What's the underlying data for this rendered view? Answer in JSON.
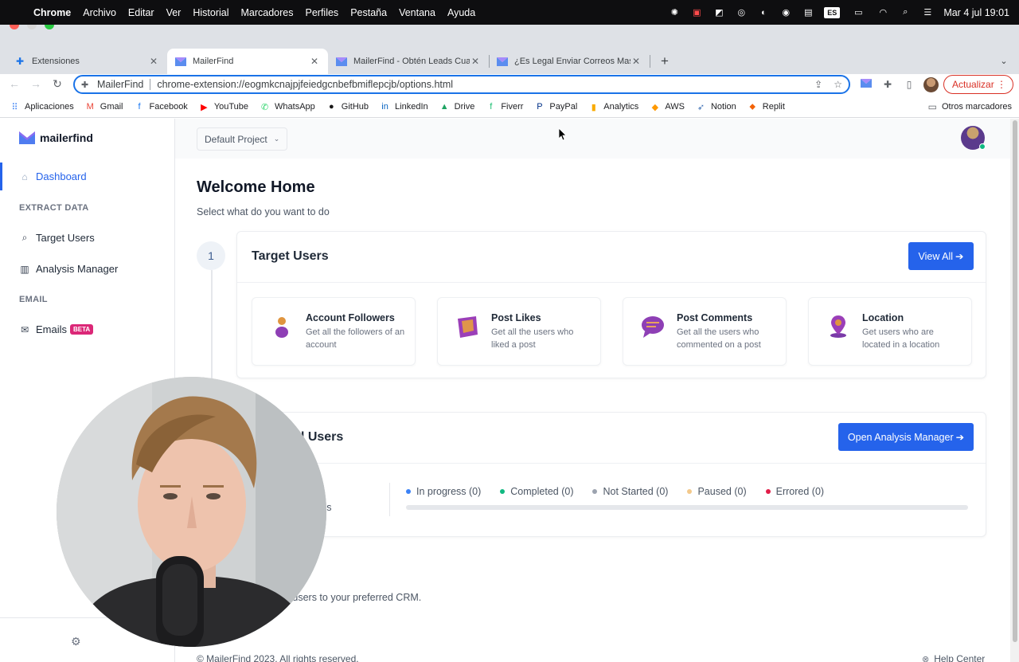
{
  "menubar": {
    "app_name": "Chrome",
    "items": [
      "Archivo",
      "Editar",
      "Ver",
      "Historial",
      "Marcadores",
      "Perfiles",
      "Pestaña",
      "Ventana",
      "Ayuda"
    ],
    "status_badge": "ES",
    "clock": "Mar 4 jul 19:01"
  },
  "tabs": [
    {
      "title": "Extensiones",
      "icon": "puzzle-icon"
    },
    {
      "title": "MailerFind",
      "icon": "mailerfind-logo-icon"
    },
    {
      "title": "MailerFind - Obtén Leads Cual",
      "icon": "mailerfind-logo-icon"
    },
    {
      "title": "¿Es Legal Enviar Correos Masiv",
      "icon": "mailerfind-logo-icon"
    }
  ],
  "omnibox": {
    "site_name": "MailerFind",
    "url": "chrome-extension://eogmkcnajpjfeiedgcnbefbmiflepcjb/options.html"
  },
  "toolbar": {
    "update_label": "Actualizar"
  },
  "bookmarks": [
    {
      "label": "Aplicaciones",
      "icon": "apps-grid-icon",
      "color": "#4285f4"
    },
    {
      "label": "Gmail",
      "icon": "gmail-icon",
      "color": "#ea4335"
    },
    {
      "label": "Facebook",
      "icon": "facebook-icon",
      "color": "#1877f2"
    },
    {
      "label": "YouTube",
      "icon": "youtube-icon",
      "color": "#ff0000"
    },
    {
      "label": "WhatsApp",
      "icon": "whatsapp-icon",
      "color": "#25d366"
    },
    {
      "label": "GitHub",
      "icon": "github-icon",
      "color": "#181717"
    },
    {
      "label": "LinkedIn",
      "icon": "linkedin-icon",
      "color": "#0a66c2"
    },
    {
      "label": "Drive",
      "icon": "drive-icon",
      "color": "#1fa463"
    },
    {
      "label": "Fiverr",
      "icon": "fiverr-icon",
      "color": "#1dbf73"
    },
    {
      "label": "PayPal",
      "icon": "paypal-icon",
      "color": "#003087"
    },
    {
      "label": "Analytics",
      "icon": "analytics-icon",
      "color": "#f9ab00"
    },
    {
      "label": "AWS",
      "icon": "aws-icon",
      "color": "#ff9900"
    },
    {
      "label": "Notion",
      "icon": "notion-icon",
      "color": "#3c6fb5"
    },
    {
      "label": "Replit",
      "icon": "replit-icon",
      "color": "#f26207"
    }
  ],
  "other_bookmarks": "Otros marcadores",
  "sidebar": {
    "logo_text": "mailerfind",
    "items": [
      {
        "label": "Dashboard",
        "icon": "home-icon"
      },
      {
        "label": "Target Users",
        "icon": "search-icon"
      },
      {
        "label": "Analysis Manager",
        "icon": "analysis-icon"
      },
      {
        "label": "Emails",
        "icon": "mail-icon",
        "badge": "BETA"
      }
    ],
    "sections": [
      "EXTRACT DATA",
      "EMAIL"
    ]
  },
  "main": {
    "project_select": "Default Project",
    "welcome_title": "Welcome Home",
    "welcome_subtitle": "Select what do you want to do",
    "step_number": "1",
    "target_card": {
      "title": "Target Users",
      "button": "View All",
      "options": [
        {
          "title": "Account Followers",
          "desc": "Get all the followers of an account",
          "icon": "followers-icon"
        },
        {
          "title": "Post Likes",
          "desc": "Get all the users who liked a post",
          "icon": "likes-icon"
        },
        {
          "title": "Post Comments",
          "desc": "Get all the users who commented on a post",
          "icon": "comments-icon"
        },
        {
          "title": "Location",
          "desc": "Get users who are located in a location",
          "icon": "location-icon"
        }
      ]
    },
    "analysis_card": {
      "title": "Targeted Users",
      "button": "Open Analysis Manager",
      "partial_label": "lyses",
      "legend": [
        {
          "label": "In progress (0)",
          "color": "#3b82f6"
        },
        {
          "label": "Completed (0)",
          "color": "#10b981"
        },
        {
          "label": "Not Started (0)",
          "color": "#9ca3af"
        },
        {
          "label": "Paused (0)",
          "color": "#f3c98b"
        },
        {
          "label": "Errored (0)",
          "color": "#e11d48"
        }
      ],
      "progress": 0
    },
    "crm_text": "ed users to your preferred CRM.",
    "footer": "© MailerFind 2023. All rights reserved.",
    "help_center": "Help Center"
  },
  "colors": {
    "accent": "#2563eb",
    "beta": "#db2777",
    "online": "#10b981"
  }
}
